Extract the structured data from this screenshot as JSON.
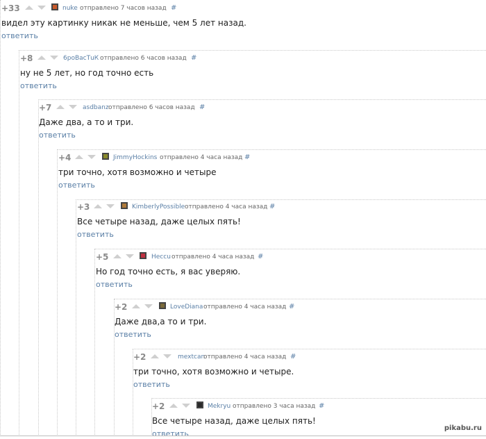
{
  "comments": [
    {
      "rating": "+33",
      "author": "nuke",
      "sent": "отправлено 7 часов назад",
      "hash": "#",
      "text": "видел эту картинку никак не меньше, чем 5 лет назад.",
      "reply": "ответить",
      "avatar": "#c85a2a"
    },
    {
      "rating": "+8",
      "author": "6роВасТuК",
      "sent": "отправлено 6 часов назад",
      "hash": "#",
      "text": "ну не 5 лет, но год точно есть",
      "reply": "ответить",
      "avatar": ""
    },
    {
      "rating": "+7",
      "author": "asdbanz",
      "sent": "отправлено 6 часов назад",
      "hash": "#",
      "text": "Даже два, а то и три.",
      "reply": "ответить",
      "avatar": ""
    },
    {
      "rating": "+4",
      "author": "JimmyHockins",
      "sent": "отправлено 4 часа назад",
      "hash": "#",
      "text": "три точно, хотя возможно и четыре",
      "reply": "ответить",
      "avatar": "#8a8a2a"
    },
    {
      "rating": "+3",
      "author": "KimberlyPossible",
      "sent": "отправлено 4 часа назад",
      "hash": "#",
      "text": "Все четыре назад, даже целых пять!",
      "reply": "ответить",
      "avatar": "#b07a3a"
    },
    {
      "rating": "+5",
      "author": "Неccu",
      "sent": "отправлено 4 часа назад",
      "hash": "#",
      "text": "Но год точно есть, я вас уверяю.",
      "reply": "ответить",
      "avatar": "#c03040"
    },
    {
      "rating": "+2",
      "author": "LoveDiana",
      "sent": "отправлено 4 часа назад",
      "hash": "#",
      "text": "Даже два,а то и три.",
      "reply": "ответить",
      "avatar": "#7a6a3a"
    },
    {
      "rating": "+2",
      "author": "mextcan",
      "sent": "отправлено 4 часа назад",
      "hash": "#",
      "text": "три точно, хотя возможно и четыре.",
      "reply": "ответить",
      "avatar": ""
    },
    {
      "rating": "+2",
      "author": "Mekryu",
      "sent": "отправлено 3 часа назад",
      "hash": "#",
      "text": "Все четыре назад, даже целых пять!",
      "reply": "ответить",
      "avatar": "#2a2a2a"
    }
  ],
  "watermark": "pikabu.ru",
  "colors": {
    "link": "#5a7fa6",
    "rating": "#8a8a8a",
    "arrow": "#cfcfcf",
    "text": "#1e1e1e"
  }
}
